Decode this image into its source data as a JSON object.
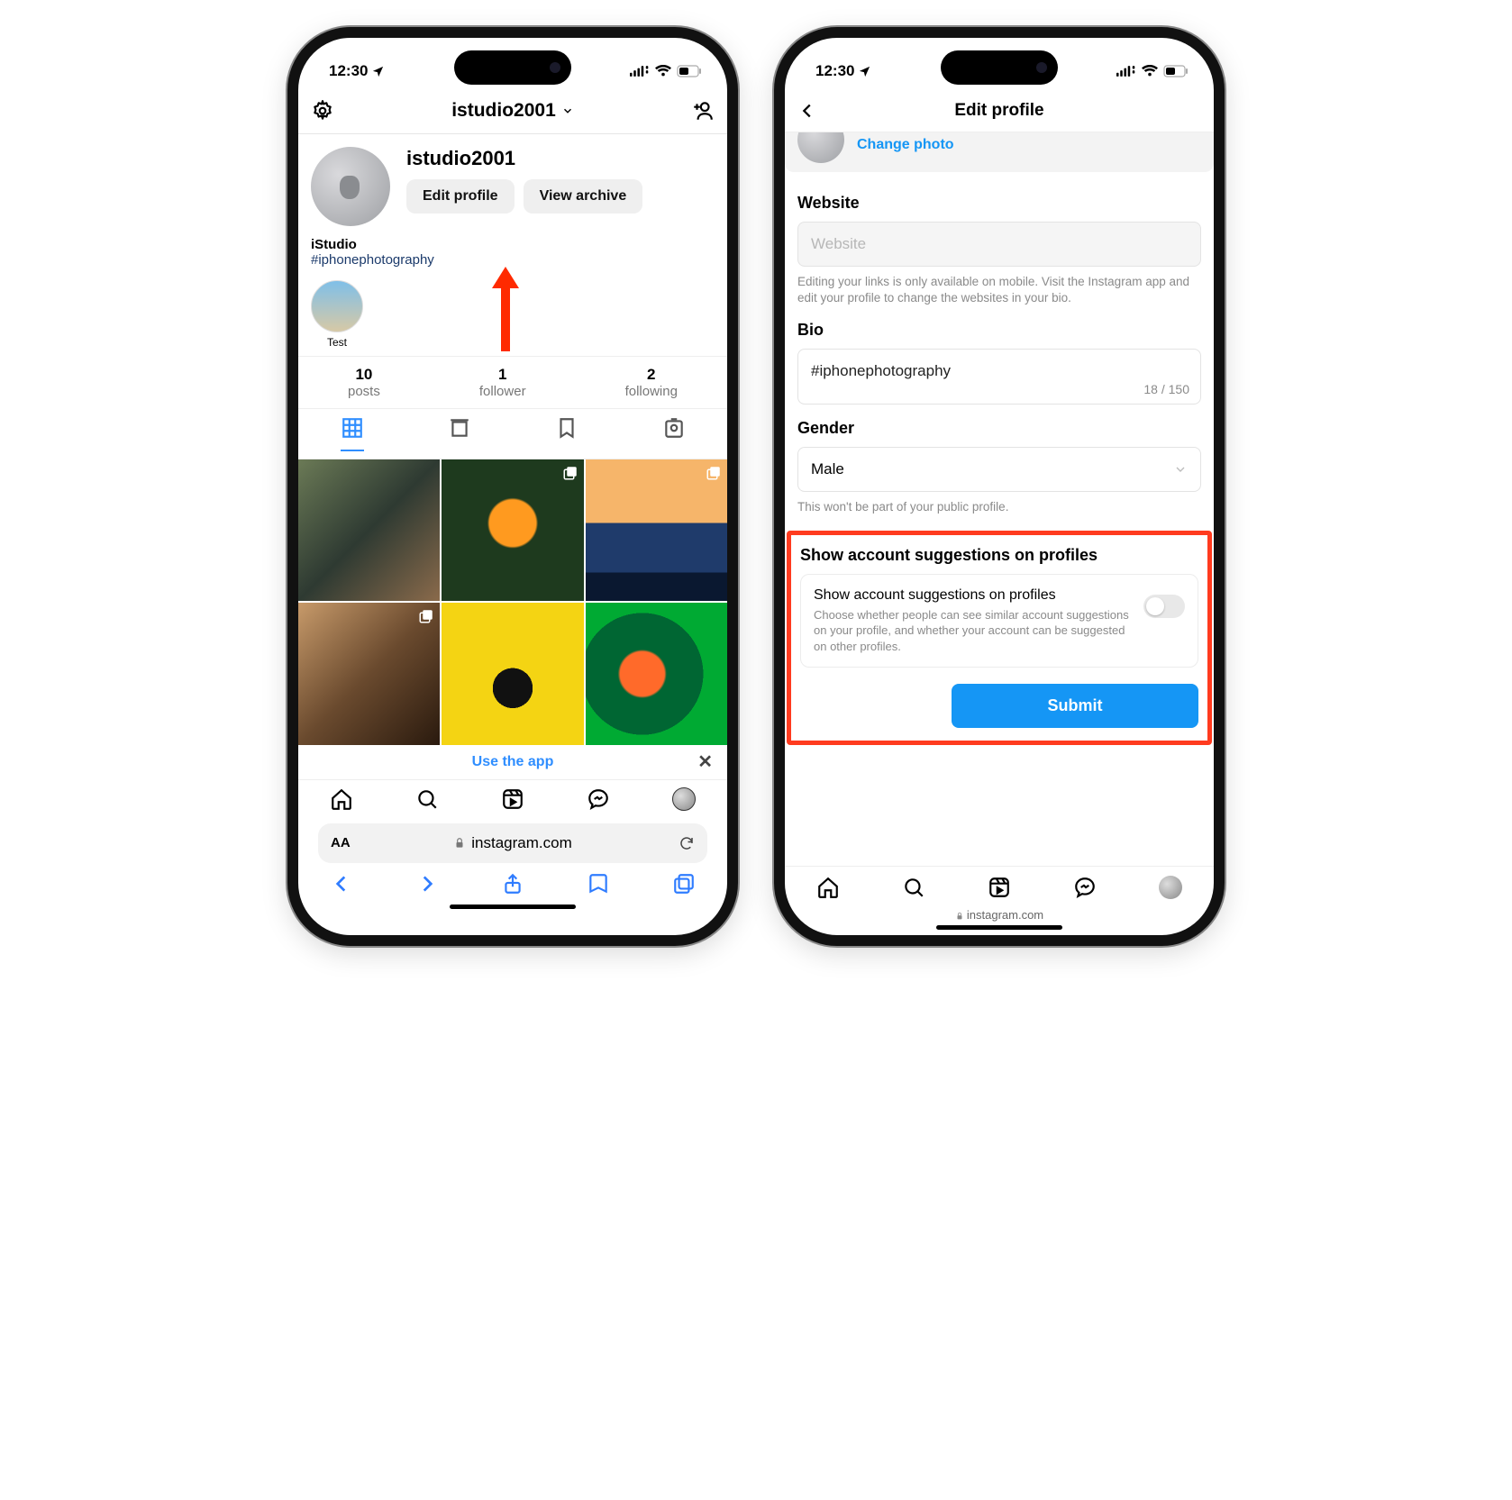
{
  "status": {
    "time": "12:30"
  },
  "phone1": {
    "header": {
      "username": "istudio2001"
    },
    "profile": {
      "username": "istudio2001",
      "edit_btn": "Edit profile",
      "archive_btn": "View archive",
      "display_name": "iStudio",
      "hashtag": "#iphonephotography",
      "highlight_label": "Test"
    },
    "stats": {
      "posts_n": "10",
      "posts_l": "posts",
      "followers_n": "1",
      "followers_l": "follower",
      "following_n": "2",
      "following_l": "following"
    },
    "usebar": "Use the app",
    "url": "instagram.com",
    "aa": "AA"
  },
  "phone2": {
    "header_title": "Edit profile",
    "change_photo": "Change photo",
    "website": {
      "label": "Website",
      "placeholder": "Website",
      "hint": "Editing your links is only available on mobile. Visit the Instagram app and edit your profile to change the websites in your bio."
    },
    "bio": {
      "label": "Bio",
      "value": "#iphonephotography",
      "counter": "18 / 150"
    },
    "gender": {
      "label": "Gender",
      "value": "Male",
      "hint": "This won't be part of your public profile."
    },
    "suggest": {
      "heading": "Show account suggestions on profiles",
      "title": "Show account suggestions on profiles",
      "desc": "Choose whether people can see similar account suggestions on your profile, and whether your account can be suggested on other profiles."
    },
    "submit": "Submit",
    "mini_url": "instagram.com"
  }
}
